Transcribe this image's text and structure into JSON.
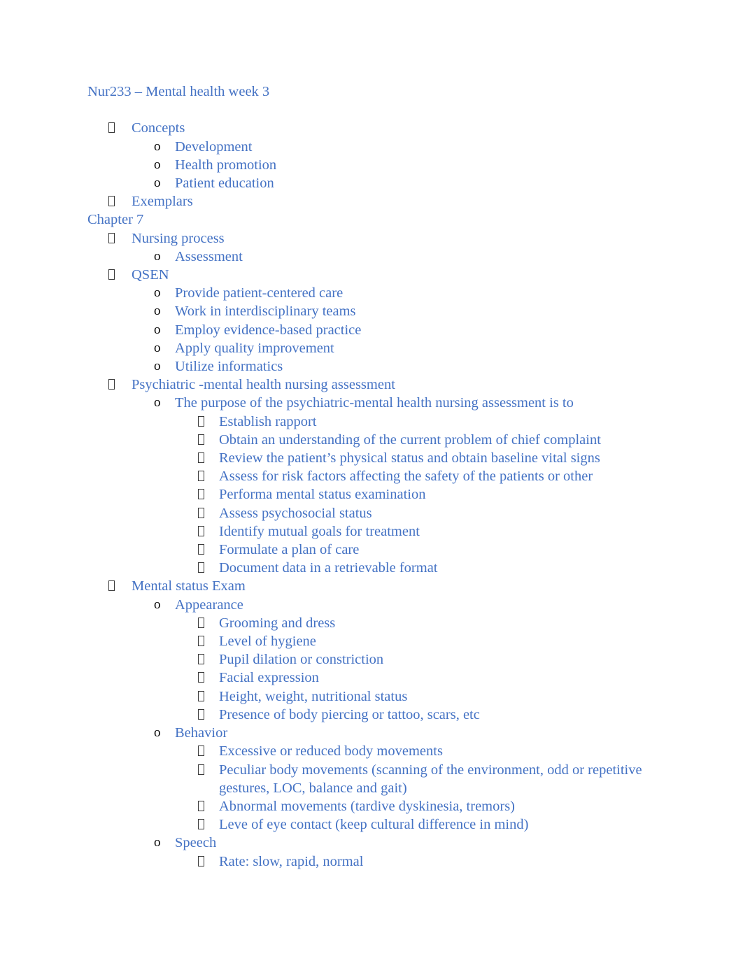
{
  "document": {
    "title": "Nur233 – Mental health week 3",
    "text_color": "#4472C4",
    "bullet_color": "#000000",
    "blocks": [
      {
        "kind": "heading",
        "level": 0,
        "bullet": "none",
        "text": "Nur233 – Mental health week 3"
      },
      {
        "kind": "blank",
        "level": 0,
        "bullet": "none",
        "text": ""
      },
      {
        "kind": "item",
        "level": 1,
        "bullet": "tofu",
        "text": "Concepts"
      },
      {
        "kind": "item",
        "level": 2,
        "bullet": "o",
        "text": "Development"
      },
      {
        "kind": "item",
        "level": 2,
        "bullet": "o",
        "text": "Health promotion"
      },
      {
        "kind": "item",
        "level": 2,
        "bullet": "o",
        "text": "Patient education"
      },
      {
        "kind": "item",
        "level": 1,
        "bullet": "tofu",
        "text": "Exemplars"
      },
      {
        "kind": "paragraph",
        "level": 0,
        "bullet": "none",
        "text": "Chapter 7"
      },
      {
        "kind": "item",
        "level": 1,
        "bullet": "tofu",
        "text": "Nursing process"
      },
      {
        "kind": "item",
        "level": 2,
        "bullet": "o",
        "text": "Assessment"
      },
      {
        "kind": "item",
        "level": 1,
        "bullet": "tofu",
        "text": "QSEN"
      },
      {
        "kind": "item",
        "level": 2,
        "bullet": "o",
        "text": "Provide patient-centered care"
      },
      {
        "kind": "item",
        "level": 2,
        "bullet": "o",
        "text": "Work in interdisciplinary teams"
      },
      {
        "kind": "item",
        "level": 2,
        "bullet": "o",
        "text": "Employ evidence-based practice"
      },
      {
        "kind": "item",
        "level": 2,
        "bullet": "o",
        "text": "Apply quality improvement"
      },
      {
        "kind": "item",
        "level": 2,
        "bullet": "o",
        "text": "Utilize informatics"
      },
      {
        "kind": "item",
        "level": 1,
        "bullet": "tofu",
        "text": "Psychiatric -mental health nursing assessment"
      },
      {
        "kind": "item",
        "level": 2,
        "bullet": "o",
        "text": "The purpose of the psychiatric-mental health nursing assessment is to"
      },
      {
        "kind": "item",
        "level": 3,
        "bullet": "tofu",
        "text": "Establish rapport"
      },
      {
        "kind": "item",
        "level": 3,
        "bullet": "tofu",
        "text": "Obtain an understanding of the current problem of chief complaint"
      },
      {
        "kind": "item",
        "level": 3,
        "bullet": "tofu",
        "text": "Review the patient’s physical status and obtain baseline vital signs"
      },
      {
        "kind": "item",
        "level": 3,
        "bullet": "tofu",
        "text": "Assess for risk factors affecting the safety of the patients or other"
      },
      {
        "kind": "item",
        "level": 3,
        "bullet": "tofu",
        "text": "Performa mental status examination"
      },
      {
        "kind": "item",
        "level": 3,
        "bullet": "tofu",
        "text": "Assess psychosocial status"
      },
      {
        "kind": "item",
        "level": 3,
        "bullet": "tofu",
        "text": "Identify mutual goals for treatment"
      },
      {
        "kind": "item",
        "level": 3,
        "bullet": "tofu",
        "text": "Formulate a plan of care"
      },
      {
        "kind": "item",
        "level": 3,
        "bullet": "tofu",
        "text": "Document data in a retrievable format"
      },
      {
        "kind": "item",
        "level": 1,
        "bullet": "tofu",
        "text": "Mental status Exam"
      },
      {
        "kind": "item",
        "level": 2,
        "bullet": "o",
        "text": "Appearance"
      },
      {
        "kind": "item",
        "level": 3,
        "bullet": "tofu",
        "text": "Grooming and dress"
      },
      {
        "kind": "item",
        "level": 3,
        "bullet": "tofu",
        "text": "Level of hygiene"
      },
      {
        "kind": "item",
        "level": 3,
        "bullet": "tofu",
        "text": "Pupil dilation or constriction"
      },
      {
        "kind": "item",
        "level": 3,
        "bullet": "tofu",
        "text": "Facial expression"
      },
      {
        "kind": "item",
        "level": 3,
        "bullet": "tofu",
        "text": "Height, weight, nutritional status"
      },
      {
        "kind": "item",
        "level": 3,
        "bullet": "tofu",
        "text": "Presence of body piercing or tattoo, scars, etc"
      },
      {
        "kind": "item",
        "level": 2,
        "bullet": "o",
        "text": "Behavior"
      },
      {
        "kind": "item",
        "level": 3,
        "bullet": "tofu",
        "text": "Excessive or reduced body movements"
      },
      {
        "kind": "item",
        "level": 3,
        "bullet": "tofu",
        "text": "Peculiar body movements (scanning of the environment, odd or repetitive gestures, LOC, balance and gait)"
      },
      {
        "kind": "item",
        "level": 3,
        "bullet": "tofu",
        "text": "Abnormal movements (tardive dyskinesia, tremors)"
      },
      {
        "kind": "item",
        "level": 3,
        "bullet": "tofu",
        "text": "Leve of eye contact (keep cultural difference in mind)"
      },
      {
        "kind": "item",
        "level": 2,
        "bullet": "o",
        "text": "Speech"
      },
      {
        "kind": "item",
        "level": 3,
        "bullet": "tofu",
        "text": "Rate: slow, rapid, normal"
      }
    ]
  }
}
